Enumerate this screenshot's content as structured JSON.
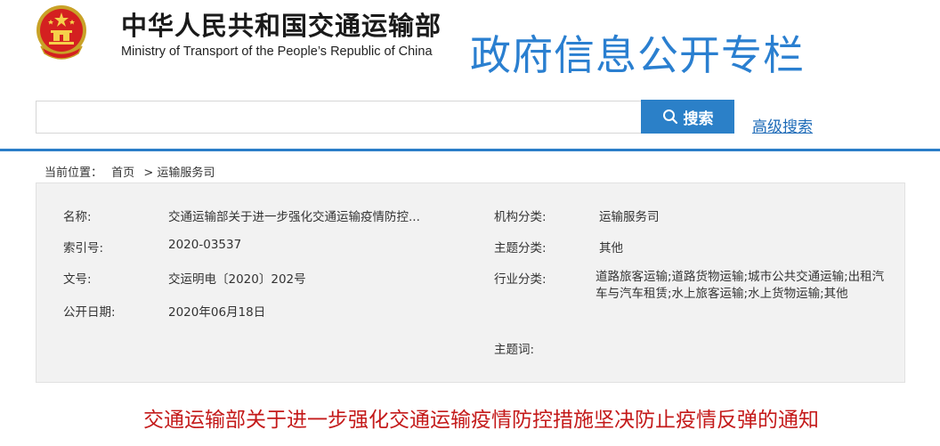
{
  "header": {
    "ministry_name_cn": "中华人民共和国交通运输部",
    "ministry_name_en": "Ministry of Transport of the People’s Republic of China",
    "column_title": "政府信息公开专栏",
    "emblem_icon": "national-emblem-icon"
  },
  "search": {
    "placeholder": "",
    "value": "",
    "button_label": "搜索",
    "button_icon": "search-icon",
    "advanced_label": "高级搜索"
  },
  "breadcrumb": {
    "prefix": "当前位置：",
    "home": "首页",
    "separator": ">",
    "current": "运输服务司"
  },
  "info": {
    "name_label": "名称:",
    "name_value": "交通运输部关于进一步强化交通运输疫情防控...",
    "index_label": "索引号:",
    "index_value": "2020-03537",
    "docno_label": "文号:",
    "docno_value": "交运明电〔2020〕202号",
    "date_label": "公开日期:",
    "date_value": "2020年06月18日",
    "org_label": "机构分类:",
    "org_value": "运输服务司",
    "topic_label": "主题分类:",
    "topic_value": "其他",
    "industry_label": "行业分类:",
    "industry_value": "道路旅客运输;道路货物运输;城市公共交通运输;出租汽车与汽车租赁;水上旅客运输;水上货物运输;其他",
    "keywords_label": "主题词:",
    "keywords_value": ""
  },
  "document_title": "交通运输部关于进一步强化交通运输疫情防控措施坚决防止疫情反弹的通知",
  "colors": {
    "accent_blue": "#2b80c8",
    "title_blue": "#2a7fd0",
    "doc_title_red": "#c41a1a",
    "info_bg": "#f2f2f2"
  }
}
